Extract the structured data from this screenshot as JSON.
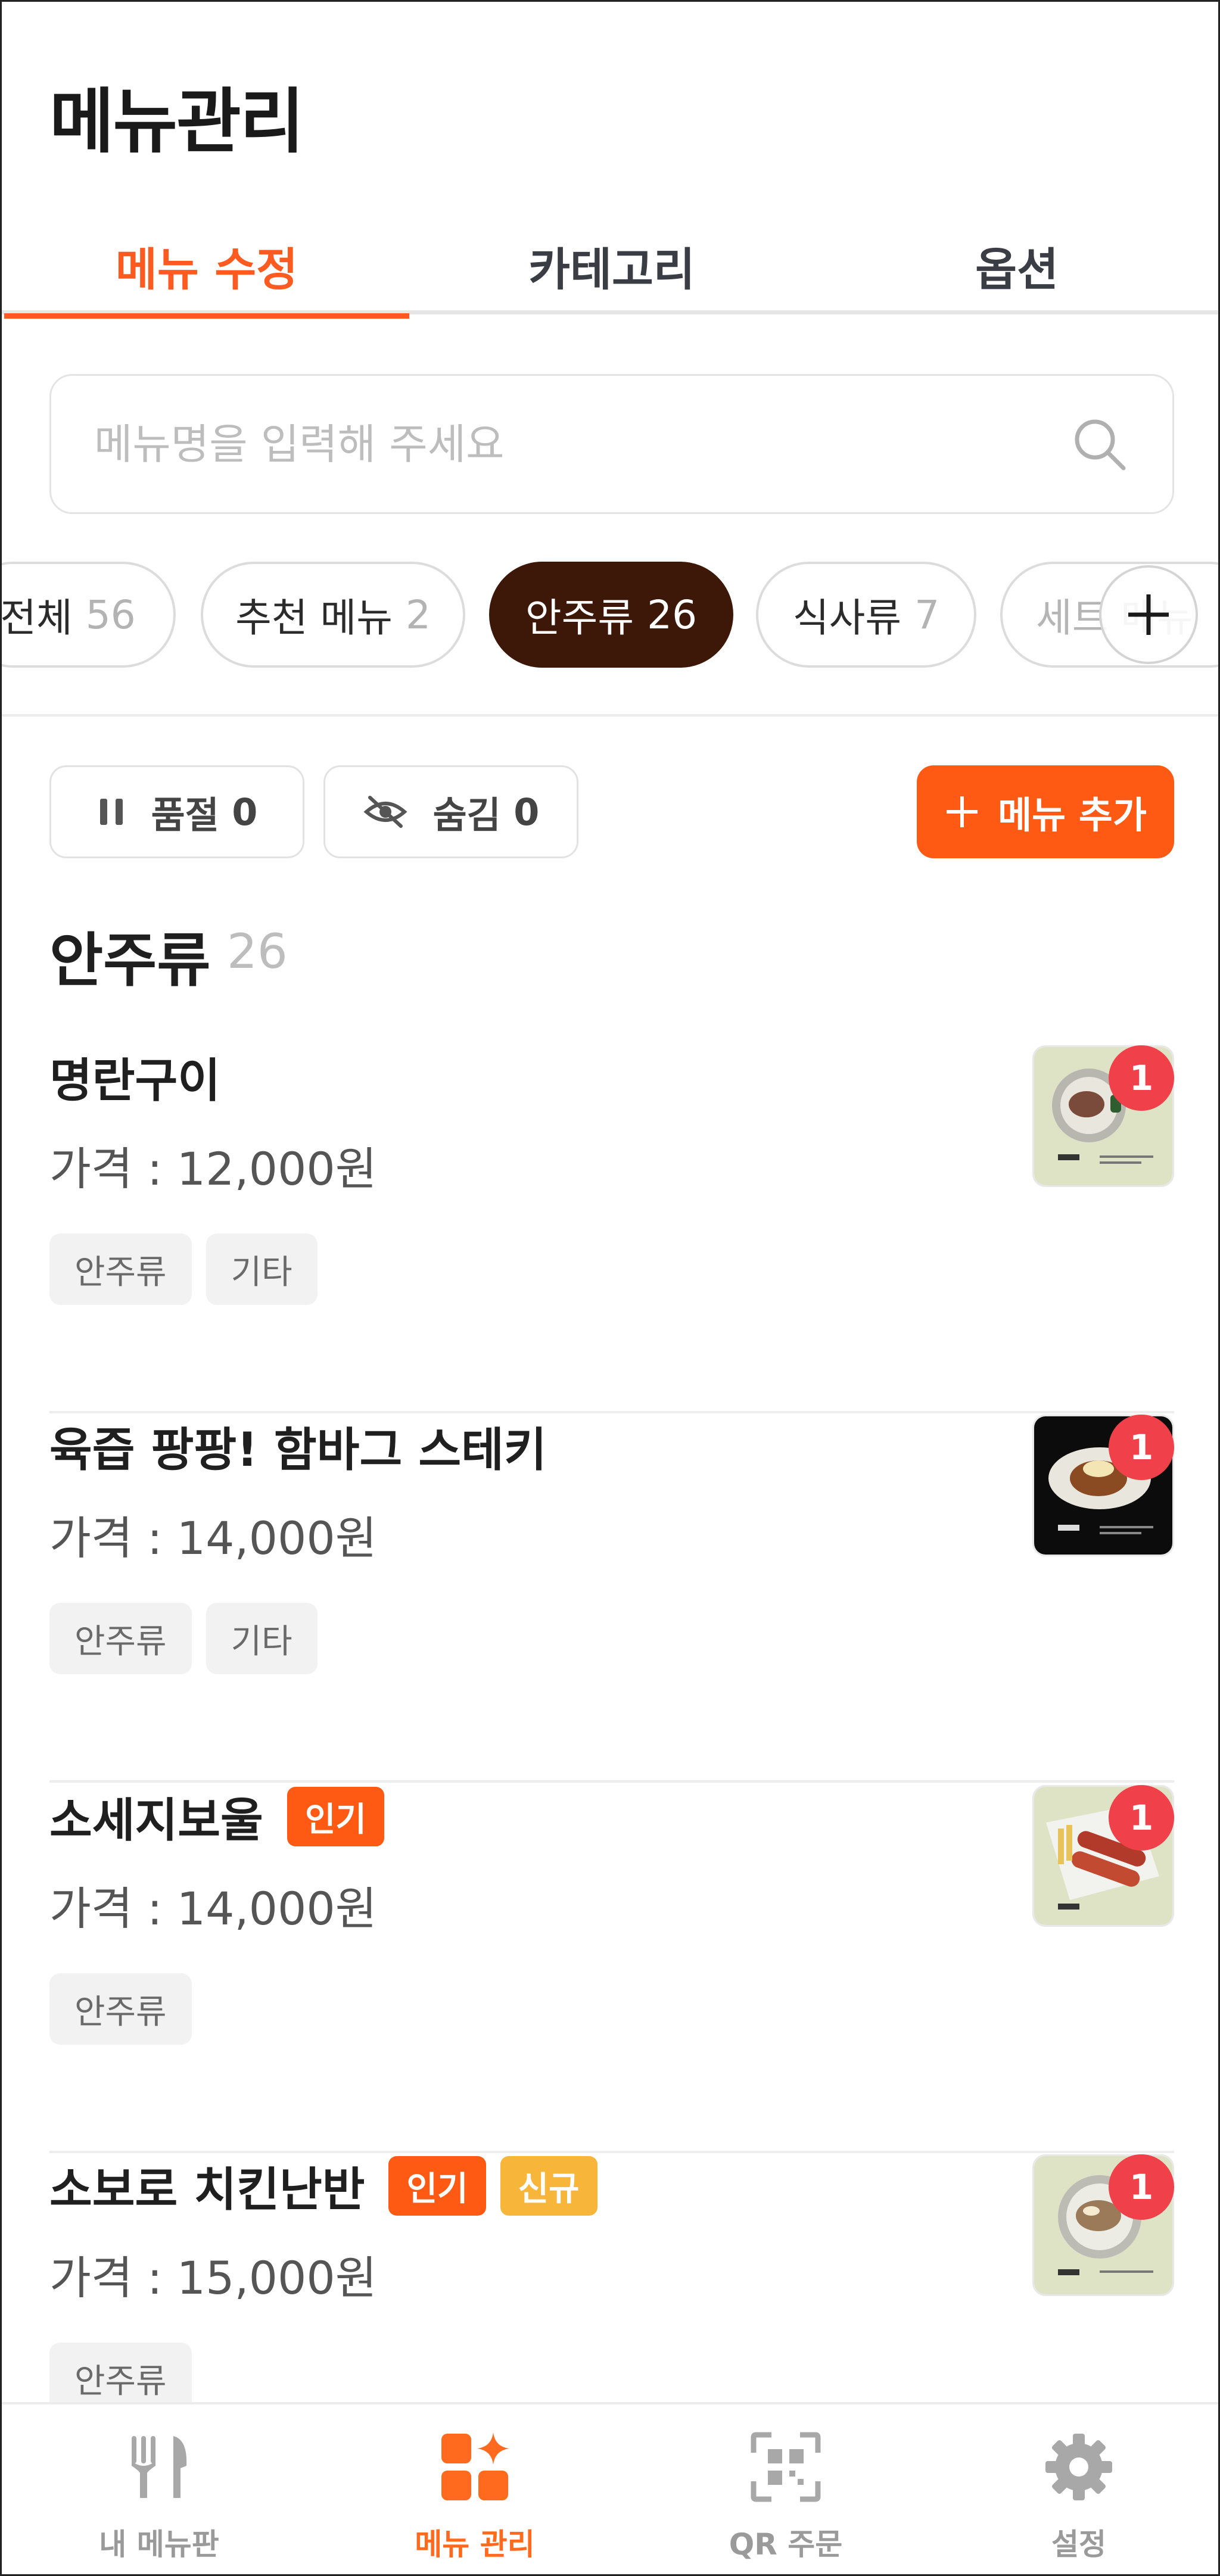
{
  "header": {
    "title": "메뉴관리"
  },
  "tabs": [
    {
      "label": "메뉴 수정",
      "active": true
    },
    {
      "label": "카테고리",
      "active": false
    },
    {
      "label": "옵션",
      "active": false
    }
  ],
  "search": {
    "placeholder": "메뉴명을 입력해 주세요",
    "value": ""
  },
  "categories": [
    {
      "label": "전체",
      "count": "56"
    },
    {
      "label": "추천 메뉴",
      "count": "2"
    },
    {
      "label": "안주류",
      "count": "26",
      "active": true
    },
    {
      "label": "식사류",
      "count": "7"
    },
    {
      "label": "세트 메뉴",
      "count": ""
    }
  ],
  "filters": {
    "soldout_label": "품절",
    "soldout_count": "0",
    "hidden_label": "숨김",
    "hidden_count": "0",
    "add_label": "메뉴 추가"
  },
  "section": {
    "title": "안주류",
    "count": "26"
  },
  "menu_items": [
    {
      "name": "명란구이",
      "price": "가격 : 12,000원",
      "tags": [
        "안주류",
        "기타"
      ],
      "badges": [],
      "thumb_count": "1"
    },
    {
      "name": "육즙 팡팡! 함바그 스테키",
      "price": "가격 : 14,000원",
      "tags": [
        "안주류",
        "기타"
      ],
      "badges": [],
      "thumb_count": "1"
    },
    {
      "name": "소세지보울",
      "price": "가격 : 14,000원",
      "tags": [
        "안주류"
      ],
      "badges": [
        {
          "label": "인기",
          "color": "#ff5a14"
        }
      ],
      "thumb_count": "1"
    },
    {
      "name": "소보로 치킨난반",
      "price": "가격 : 15,000원",
      "tags": [
        "안주류"
      ],
      "badges": [
        {
          "label": "인기",
          "color": "#ff5a14"
        },
        {
          "label": "신규",
          "color": "#f7b53a"
        }
      ],
      "thumb_count": "1"
    }
  ],
  "bottom_nav": [
    {
      "label": "내 메뉴판",
      "icon": "fork-knife-icon",
      "active": false
    },
    {
      "label": "메뉴 관리",
      "icon": "menu-grid-icon",
      "active": true
    },
    {
      "label": "QR 주문",
      "icon": "qr-scan-icon",
      "active": false
    },
    {
      "label": "설정",
      "icon": "gear-icon",
      "active": false
    }
  ],
  "colors": {
    "accent": "#ff5a14",
    "active_chip": "#3d1707",
    "badge_popular": "#ff5a14",
    "badge_new": "#f7b53a",
    "thumb_badge": "#f0404a"
  }
}
